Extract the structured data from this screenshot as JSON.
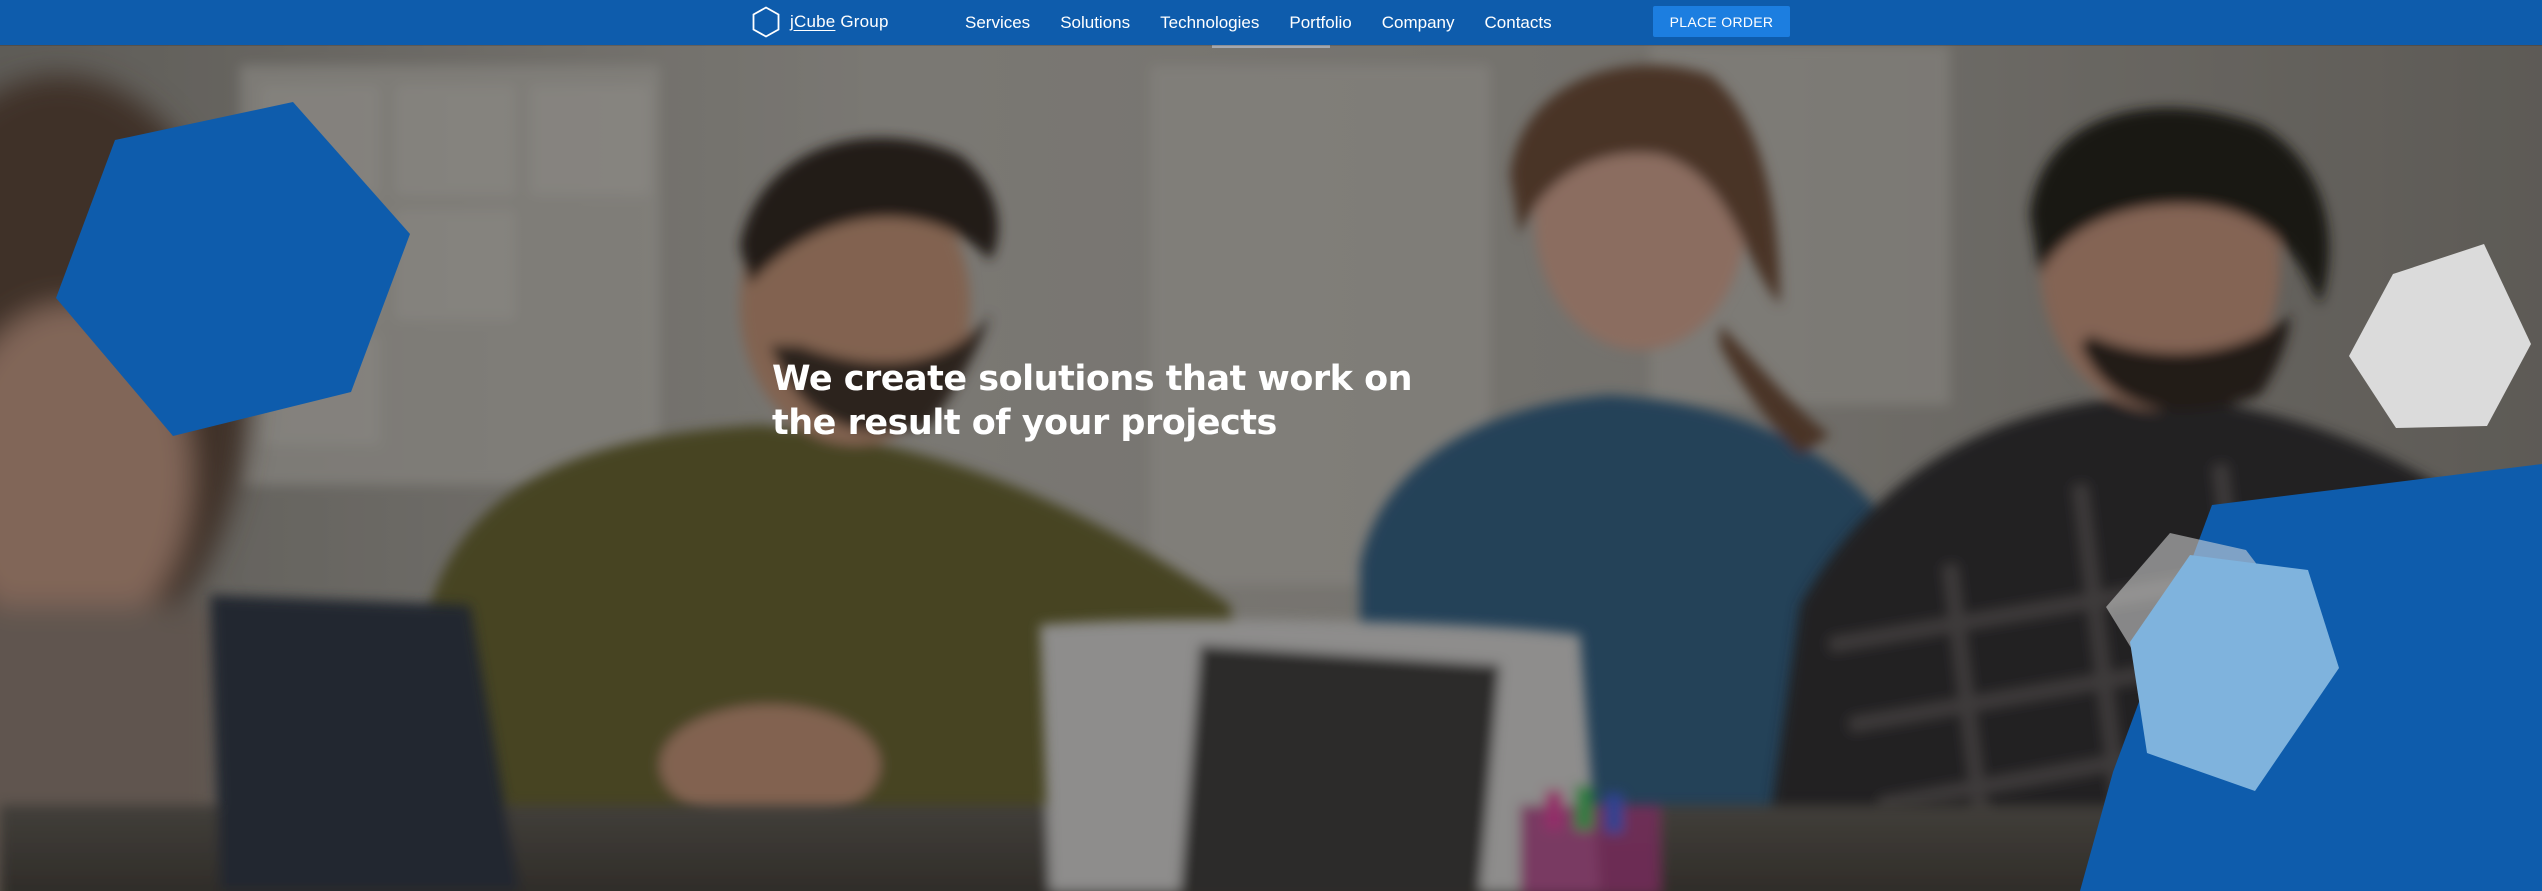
{
  "header": {
    "logo": {
      "brand": "jCube",
      "suffix": " Group",
      "icon": "hexagon-outline-icon"
    },
    "nav": [
      {
        "label": "Services"
      },
      {
        "label": "Solutions"
      },
      {
        "label": "Technologies"
      },
      {
        "label": "Portfolio"
      },
      {
        "label": "Company"
      },
      {
        "label": "Contacts"
      }
    ],
    "cta_label": "PLACE ORDER"
  },
  "hero": {
    "headline_line1": "We create solutions that work on",
    "headline_line2": "the result of your projects"
  },
  "colors": {
    "brand_blue": "#0e5cac",
    "cta_blue": "#1c7ee0",
    "light_hexagon": "#7fb3dd",
    "white_hexagon": "#e6e6e6"
  }
}
